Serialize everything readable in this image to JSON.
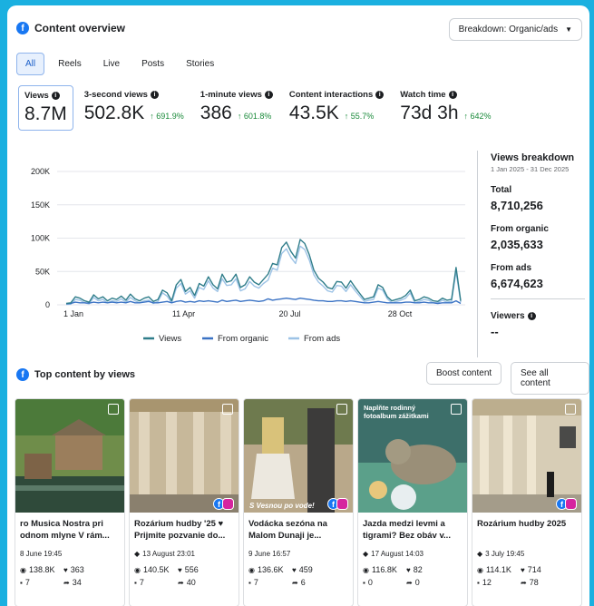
{
  "header": {
    "title": "Content overview",
    "breakdown_label": "Breakdown: Organic/ads"
  },
  "tabs": [
    {
      "label": "All"
    },
    {
      "label": "Reels"
    },
    {
      "label": "Live"
    },
    {
      "label": "Posts"
    },
    {
      "label": "Stories"
    }
  ],
  "metrics": [
    {
      "label": "Views",
      "value": "8.7M",
      "delta": ""
    },
    {
      "label": "3-second views",
      "value": "502.8K",
      "delta": "↑ 691.9%"
    },
    {
      "label": "1-minute views",
      "value": "386",
      "delta": "↑ 601.8%"
    },
    {
      "label": "Content interactions",
      "value": "43.5K",
      "delta": "↑ 55.7%"
    },
    {
      "label": "Watch time",
      "value": "73d 3h",
      "delta": "↑ 642%"
    }
  ],
  "chart_data": {
    "type": "line",
    "x_ticks": [
      "1 Jan",
      "11 Apr",
      "20 Jul",
      "28 Oct"
    ],
    "y_ticks": [
      "200K",
      "150K",
      "100K",
      "50K",
      "0"
    ],
    "ylim": [
      0,
      200000
    ],
    "series": [
      {
        "name": "Views",
        "color": "#2f7d8a",
        "values": [
          2000,
          3000,
          12000,
          10000,
          6000,
          4000,
          15000,
          9000,
          12000,
          6000,
          10000,
          8000,
          13000,
          7000,
          16000,
          9000,
          6000,
          10000,
          12000,
          5000,
          8000,
          22000,
          18000,
          6000,
          30000,
          38000,
          20000,
          26000,
          14000,
          32000,
          28000,
          42000,
          30000,
          24000,
          46000,
          34000,
          36000,
          46000,
          26000,
          30000,
          42000,
          34000,
          30000,
          38000,
          46000,
          62000,
          60000,
          86000,
          94000,
          80000,
          70000,
          98000,
          92000,
          75000,
          52000,
          40000,
          34000,
          26000,
          24000,
          35000,
          34000,
          25000,
          36000,
          26000,
          17000,
          8000,
          10000,
          12000,
          30000,
          26000,
          12000,
          6000,
          8000,
          10000,
          14000,
          22000,
          6000,
          8000,
          12000,
          10000,
          6000,
          5000,
          10000,
          7000,
          8000,
          56000,
          6000
        ]
      },
      {
        "name": "From organic",
        "color": "#3a72c4",
        "values": [
          1500,
          2000,
          4000,
          3000,
          3000,
          2500,
          4000,
          3000,
          4000,
          3000,
          4000,
          3000,
          4000,
          3000,
          5000,
          3000,
          3000,
          4000,
          5000,
          3000,
          3000,
          4000,
          5000,
          3000,
          5000,
          6000,
          4000,
          5000,
          4000,
          6000,
          5000,
          6000,
          5000,
          4000,
          7000,
          5000,
          6000,
          7000,
          5000,
          6000,
          7000,
          6000,
          5000,
          6000,
          9000,
          7000,
          8000,
          9000,
          10000,
          9000,
          8000,
          10000,
          9000,
          8000,
          7000,
          6000,
          6000,
          5000,
          5000,
          6000,
          6000,
          5000,
          6000,
          5000,
          4000,
          3000,
          3000,
          4000,
          5000,
          4000,
          3000,
          3000,
          3000,
          3000,
          4000,
          4000,
          3000,
          3000,
          4000,
          3000,
          3000,
          2000,
          3000,
          3000,
          3000,
          6000,
          2000
        ]
      },
      {
        "name": "From ads",
        "color": "#9dc3e6",
        "values": [
          500,
          1000,
          8000,
          7000,
          3000,
          1500,
          11000,
          6000,
          8000,
          3000,
          6000,
          5000,
          9000,
          4000,
          11000,
          6000,
          3000,
          6000,
          7000,
          2000,
          5000,
          18000,
          13000,
          3000,
          25000,
          32000,
          16000,
          21000,
          10000,
          26000,
          23000,
          36000,
          25000,
          20000,
          39000,
          29000,
          30000,
          39000,
          21000,
          24000,
          35000,
          28000,
          25000,
          32000,
          37000,
          55000,
          52000,
          77000,
          84000,
          71000,
          62000,
          88000,
          83000,
          67000,
          45000,
          34000,
          28000,
          21000,
          19000,
          29000,
          28000,
          20000,
          30000,
          21000,
          13000,
          5000,
          7000,
          8000,
          25000,
          22000,
          9000,
          3000,
          5000,
          7000,
          10000,
          18000,
          3000,
          5000,
          8000,
          7000,
          3000,
          3000,
          7000,
          4000,
          5000,
          50000,
          4000
        ]
      }
    ],
    "legend_position": "bottom"
  },
  "side": {
    "title": "Views breakdown",
    "date_range": "1 Jan 2025 - 31 Dec 2025",
    "total_label": "Total",
    "total_value": "8,710,256",
    "organic_label": "From organic",
    "organic_value": "2,035,633",
    "ads_label": "From ads",
    "ads_value": "6,674,623",
    "viewers_label": "Viewers",
    "viewers_value": "--"
  },
  "top": {
    "title": "Top content by views",
    "boost_label": "Boost content",
    "see_all_label": "See all content"
  },
  "cards": [
    {
      "title": "ro Musica Nostra pri odnom mlyne V rám...",
      "date": "8 June 19:45",
      "views": "138.8K",
      "reactions": "363",
      "comments": "7",
      "shares": "34",
      "scheduled": false,
      "overlay": ""
    },
    {
      "title": "Rozárium hudby '25 ♥ Prijmite pozvanie do...",
      "date": "13 August 23:01",
      "views": "140.5K",
      "reactions": "556",
      "comments": "7",
      "shares": "40",
      "scheduled": true,
      "overlay": ""
    },
    {
      "title": "Vodácka sezóna na Malom Dunaji je...",
      "date": "9 June 16:57",
      "views": "136.6K",
      "reactions": "459",
      "comments": "7",
      "shares": "6",
      "scheduled": false,
      "overlay": "S Vesnou po vode!"
    },
    {
      "title": "Jazda medzi levmi a tigrami? Bez obáv v...",
      "date": "17 August 14:03",
      "views": "116.8K",
      "reactions": "82",
      "comments": "0",
      "shares": "0",
      "scheduled": true,
      "overlay": "Naplňte rodinný fotoalbum zážitkami"
    },
    {
      "title": "Rozárium hudby 2025",
      "date": "3 July 19:45",
      "views": "114.1K",
      "reactions": "714",
      "comments": "12",
      "shares": "78",
      "scheduled": true,
      "overlay": ""
    }
  ]
}
